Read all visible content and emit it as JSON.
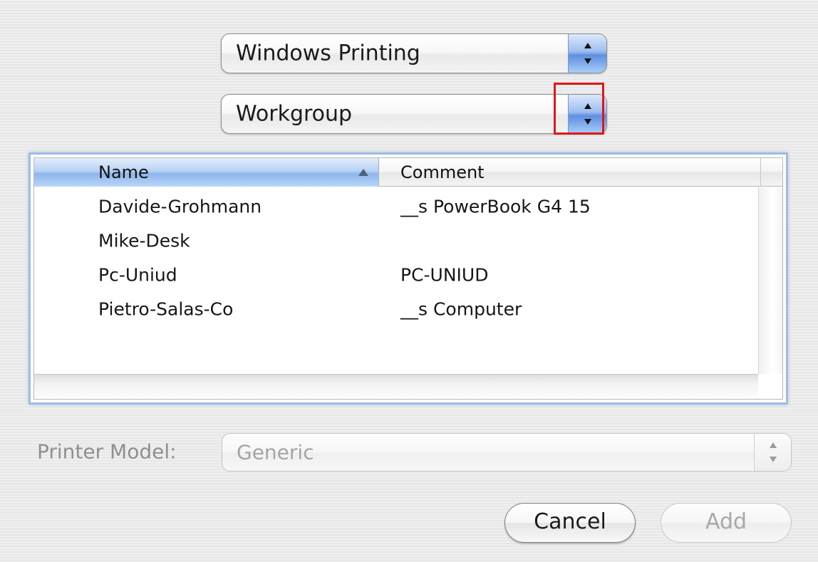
{
  "popups": {
    "service_value": "Windows Printing",
    "workgroup_value": "Workgroup"
  },
  "list": {
    "columns": {
      "name": "Name",
      "comment": "Comment"
    },
    "sort_column": "Name",
    "sort_direction": "ascending",
    "rows": [
      {
        "name": "Davide-Grohmann",
        "comment": "__s PowerBook G4 15"
      },
      {
        "name": "Mike-Desk",
        "comment": ""
      },
      {
        "name": "Pc-Uniud",
        "comment": "PC-UNIUD"
      },
      {
        "name": "Pietro-Salas-Co",
        "comment": "__s Computer"
      }
    ]
  },
  "printer_model": {
    "label": "Printer Model:",
    "value": "Generic",
    "enabled": false
  },
  "buttons": {
    "cancel": "Cancel",
    "add": "Add",
    "add_enabled": false
  },
  "colors": {
    "highlight_box": "#e01818",
    "aqua_blue": "#5f8fe0",
    "focus_ring": "#9bbde6",
    "disabled_text": "#a4a4a4"
  },
  "icons": {
    "popup_arrows": "up-down-arrows-icon",
    "sort_indicator": "sort-ascending-icon"
  }
}
